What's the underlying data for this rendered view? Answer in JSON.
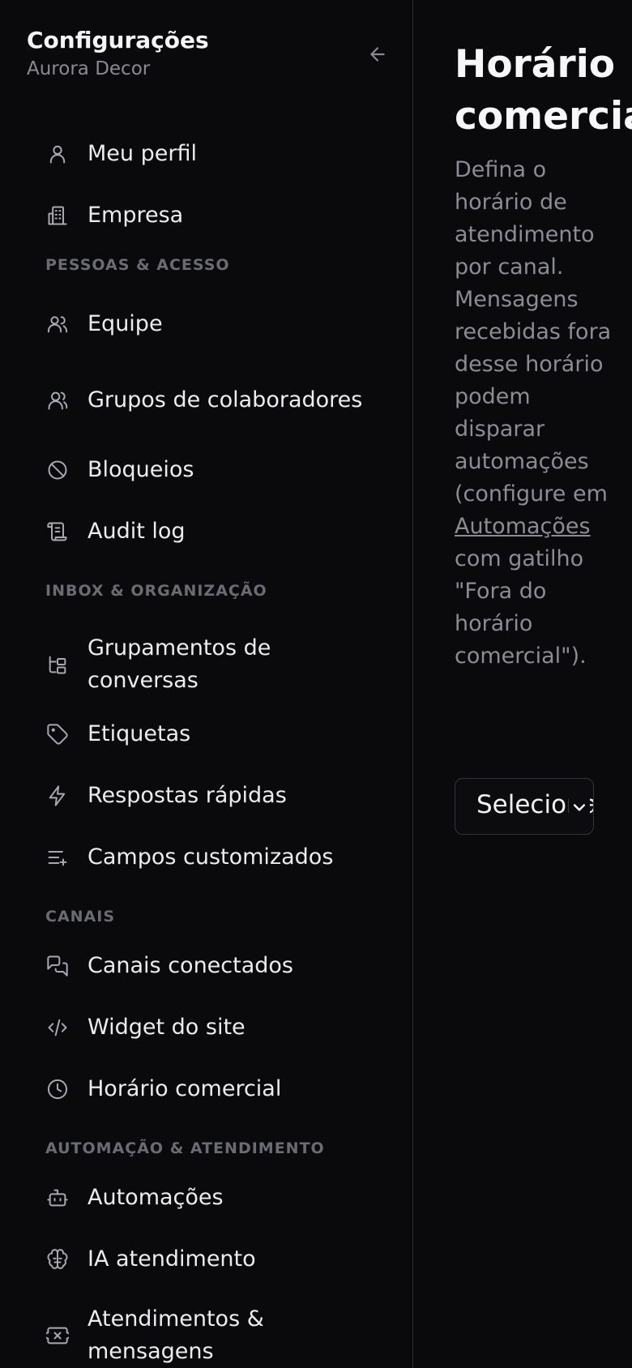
{
  "sidebar": {
    "title": "Configurações",
    "subtitle": "Aurora Decor",
    "back_icon": "arrow-left-icon",
    "top_items": [
      {
        "label": "Meu perfil",
        "icon": "user-icon"
      },
      {
        "label": "Empresa",
        "icon": "building-icon"
      }
    ],
    "sections": [
      {
        "label": "PESSOAS & ACESSO",
        "items": [
          {
            "label": "Equipe",
            "icon": "users-icon"
          },
          {
            "label": "Grupos de colaboradores",
            "icon": "user-group-icon"
          },
          {
            "label": "Bloqueios",
            "icon": "ban-icon"
          },
          {
            "label": "Audit log",
            "icon": "scroll-icon"
          }
        ]
      },
      {
        "label": "INBOX & ORGANIZAÇÃO",
        "items": [
          {
            "label": "Grupamentos de conversas",
            "icon": "tree-icon"
          },
          {
            "label": "Etiquetas",
            "icon": "tag-icon"
          },
          {
            "label": "Respostas rápidas",
            "icon": "zap-icon"
          },
          {
            "label": "Campos customizados",
            "icon": "list-plus-icon"
          }
        ]
      },
      {
        "label": "CANAIS",
        "items": [
          {
            "label": "Canais conectados",
            "icon": "messages-icon"
          },
          {
            "label": "Widget do site",
            "icon": "code-icon"
          },
          {
            "label": "Horário comercial",
            "icon": "clock-icon"
          }
        ]
      },
      {
        "label": "AUTOMAÇÃO & ATENDIMENTO",
        "items": [
          {
            "label": "Automações",
            "icon": "bot-icon"
          },
          {
            "label": "IA atendimento",
            "icon": "brain-icon"
          },
          {
            "label": "Atendimentos & mensagens",
            "icon": "ticket-icon"
          }
        ]
      }
    ]
  },
  "main": {
    "title": "Horário comercial",
    "description_before": "Defina o horário de atendimento por canal. Mensagens recebidas fora desse horário podem disparar automações (configure em ",
    "description_link": "Automações",
    "description_after": " com gatilho \"Fora do horário comercial\").",
    "select_value": "Selecionar canal",
    "select_icon": "chevron-down-icon"
  }
}
